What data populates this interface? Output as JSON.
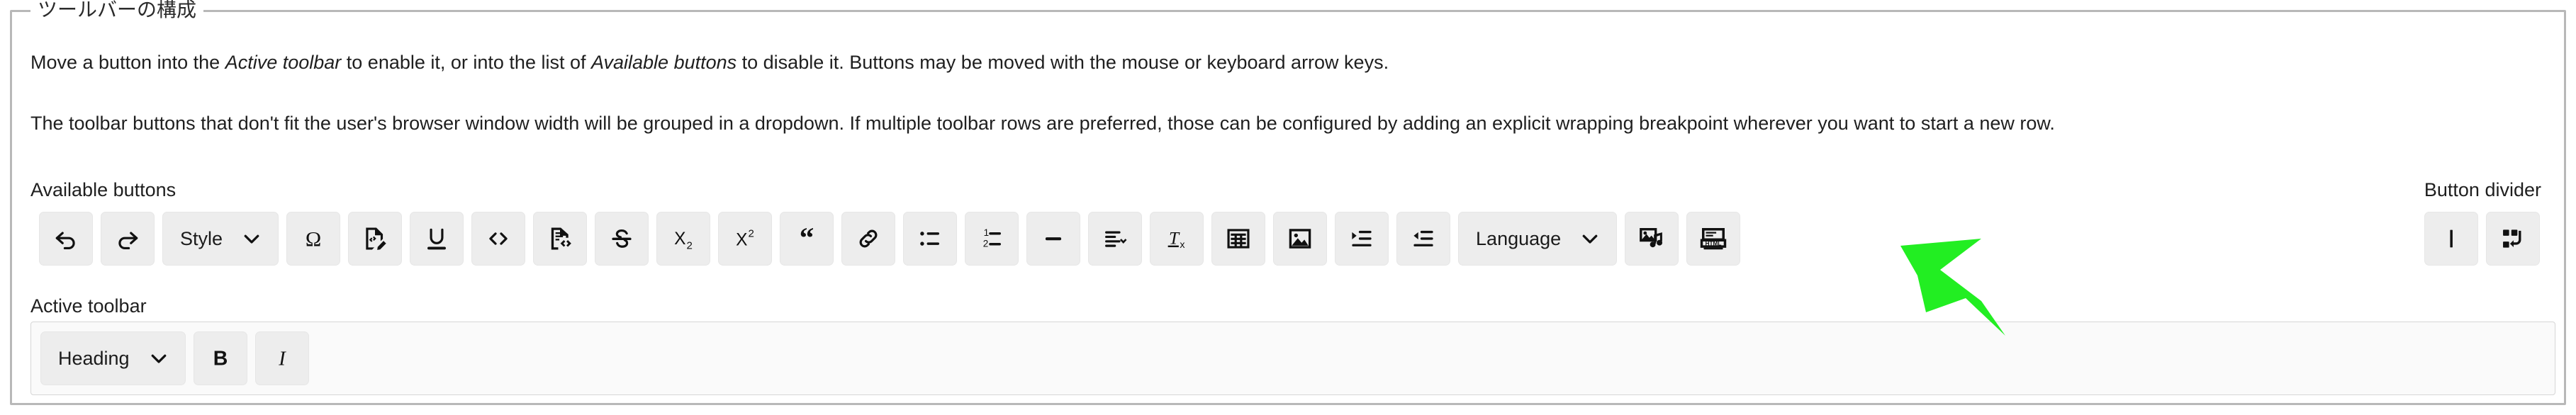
{
  "fieldset": {
    "legend": "ツールバーの構成"
  },
  "description": {
    "paragraph1": {
      "seg1": "Move a button into the ",
      "em1": "Active toolbar",
      "seg2": " to enable it, or into the list of ",
      "em2": "Available buttons",
      "seg3": " to disable it. Buttons may be moved with the mouse or keyboard arrow keys."
    },
    "paragraph2": "The toolbar buttons that don't fit the user's browser window width will be grouped in a dropdown. If multiple toolbar rows are preferred, those can be configured by adding an explicit wrapping breakpoint wherever you want to start a new row."
  },
  "labels": {
    "available_buttons": "Available buttons",
    "button_divider": "Button divider",
    "active_toolbar": "Active toolbar"
  },
  "available_buttons": [
    {
      "name": "undo",
      "icon": "undo-icon",
      "label": null
    },
    {
      "name": "redo",
      "icon": "redo-icon",
      "label": null
    },
    {
      "name": "style",
      "icon": "chevron-down-icon",
      "label": "Style"
    },
    {
      "name": "special-character",
      "icon": "omega-icon",
      "label": null
    },
    {
      "name": "source-editing",
      "icon": "code-edit-icon",
      "label": null
    },
    {
      "name": "underline",
      "icon": "underline-icon",
      "label": null
    },
    {
      "name": "code",
      "icon": "angle-brackets-icon",
      "label": null
    },
    {
      "name": "code-block",
      "icon": "document-code-icon",
      "label": null
    },
    {
      "name": "strikethrough",
      "icon": "strikethrough-icon",
      "label": null
    },
    {
      "name": "subscript",
      "icon": "subscript-icon",
      "label": null
    },
    {
      "name": "superscript",
      "icon": "superscript-icon",
      "label": null
    },
    {
      "name": "block-quote",
      "icon": "quote-icon",
      "label": null
    },
    {
      "name": "link",
      "icon": "link-icon",
      "label": null
    },
    {
      "name": "bulleted-list",
      "icon": "bulleted-list-icon",
      "label": null
    },
    {
      "name": "numbered-list",
      "icon": "numbered-list-icon",
      "label": null
    },
    {
      "name": "horizontal-line",
      "icon": "horizontal-rule-icon",
      "label": null
    },
    {
      "name": "text-alignment",
      "icon": "alignment-icon",
      "label": null
    },
    {
      "name": "remove-format",
      "icon": "remove-format-icon",
      "label": null
    },
    {
      "name": "table",
      "icon": "table-icon",
      "label": null
    },
    {
      "name": "image",
      "icon": "image-icon",
      "label": null
    },
    {
      "name": "indent",
      "icon": "indent-icon",
      "label": null
    },
    {
      "name": "outdent",
      "icon": "outdent-icon",
      "label": null
    },
    {
      "name": "language",
      "icon": "chevron-down-icon",
      "label": "Language"
    },
    {
      "name": "media",
      "icon": "media-icon",
      "label": null
    },
    {
      "name": "html",
      "icon": "html-icon",
      "label": null
    }
  ],
  "button_divider_buttons": [
    {
      "name": "divider",
      "icon": "vertical-bar-icon",
      "label": null
    },
    {
      "name": "wrapping-breakpoint",
      "icon": "wrapping-breakpoint-icon",
      "label": null
    }
  ],
  "active_toolbar_buttons": [
    {
      "name": "heading",
      "icon": "chevron-down-icon",
      "label": "Heading"
    },
    {
      "name": "bold",
      "icon": "bold-icon",
      "label": null
    },
    {
      "name": "italic",
      "icon": "italic-icon",
      "label": null
    }
  ],
  "annotation": {
    "arrow_color": "#22ee22",
    "points_at": "html"
  },
  "colors": {
    "button_bg": "#ededed",
    "fieldset_border": "#b8b8b8",
    "active_box_bg": "#fafafa",
    "text": "#1f1f1f"
  }
}
